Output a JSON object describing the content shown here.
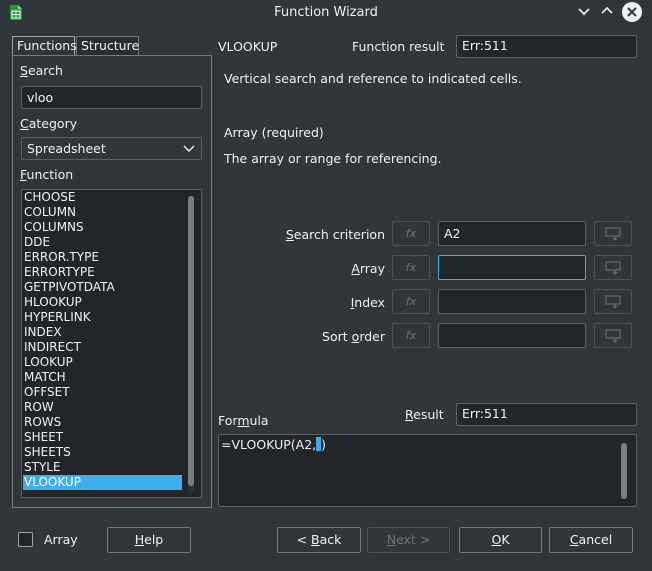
{
  "window": {
    "title": "Function Wizard"
  },
  "tabs": [
    {
      "label": "Functions"
    },
    {
      "label": "Structure"
    }
  ],
  "search": {
    "label_u": "S",
    "label_rest": "earch",
    "value": "vloo"
  },
  "category": {
    "label_u": "C",
    "label_rest": "ategory",
    "selected": "Spreadsheet"
  },
  "function_list": {
    "label_u": "F",
    "label_rest": "unction",
    "items": [
      "CHOOSE",
      "COLUMN",
      "COLUMNS",
      "DDE",
      "ERROR.TYPE",
      "ERRORTYPE",
      "GETPIVOTDATA",
      "HLOOKUP",
      "HYPERLINK",
      "INDEX",
      "INDIRECT",
      "LOOKUP",
      "MATCH",
      "OFFSET",
      "ROW",
      "ROWS",
      "SHEET",
      "SHEETS",
      "STYLE",
      "VLOOKUP"
    ],
    "selected": "VLOOKUP"
  },
  "function_info": {
    "name": "VLOOKUP",
    "result_label": "Function result",
    "result_value": "Err:511",
    "description": "Vertical search and reference to indicated cells.",
    "arg_title": "Array (required)",
    "arg_description": "The array or range for referencing."
  },
  "arguments": [
    {
      "label_pre": "",
      "label_u": "S",
      "label_post": "earch criterion",
      "value": "A2"
    },
    {
      "label_pre": "",
      "label_u": "A",
      "label_post": "rray",
      "value": ""
    },
    {
      "label_pre": "",
      "label_u": "I",
      "label_post": "ndex",
      "value": ""
    },
    {
      "label_pre": "Sort ",
      "label_u": "o",
      "label_post": "rder",
      "value": ""
    }
  ],
  "fx_label": "fx",
  "formula": {
    "label_pre": "For",
    "label_u": "m",
    "label_post": "ula",
    "text": "=VLOOKUP(A2,",
    "text_after": ")"
  },
  "result": {
    "label_u": "R",
    "label_rest": "esult",
    "value": "Err:511"
  },
  "array_checkbox": {
    "label": "Array",
    "checked": false
  },
  "buttons": {
    "help": {
      "u": "H",
      "rest": "elp"
    },
    "back": {
      "pre": "< ",
      "u": "B",
      "rest": "ack"
    },
    "next": {
      "u": "N",
      "rest": "ext >"
    },
    "ok": {
      "u": "O",
      "rest": "K"
    },
    "cancel": {
      "u": "C",
      "rest": "ancel"
    }
  },
  "colors": {
    "background": "#31363b",
    "field": "#232629",
    "accent": "#3daee9",
    "text": "#eff0f1"
  }
}
